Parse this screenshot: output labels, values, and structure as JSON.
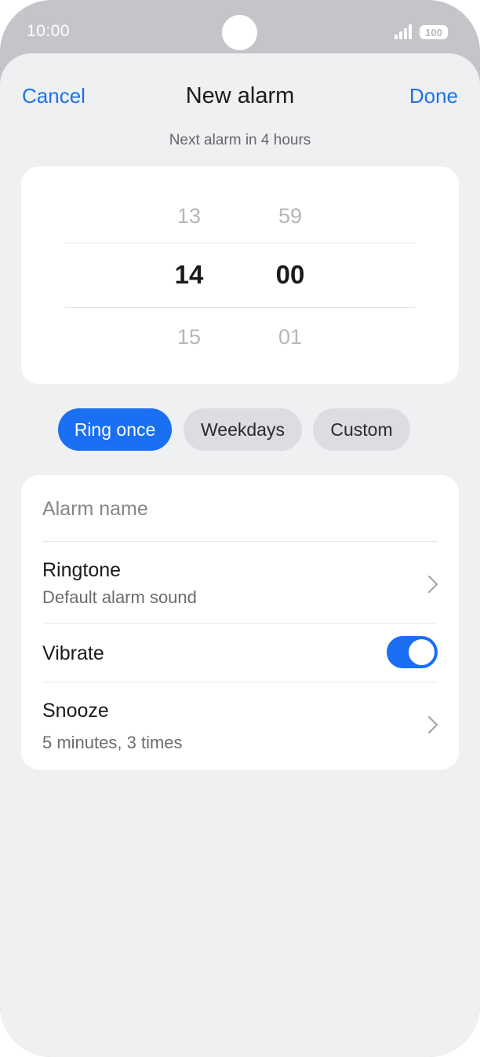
{
  "status": {
    "time": "10:00",
    "battery": "100"
  },
  "nav": {
    "cancel_label": "Cancel",
    "title": "New alarm",
    "done_label": "Done"
  },
  "subtitle": "Next alarm in 4 hours",
  "picker": {
    "hours": {
      "prev": "13",
      "selected": "14",
      "next": "15"
    },
    "minutes": {
      "prev": "59",
      "selected": "00",
      "next": "01"
    }
  },
  "repeat_options": [
    {
      "label": "Ring once",
      "active": true
    },
    {
      "label": "Weekdays",
      "active": false
    },
    {
      "label": "Custom",
      "active": false
    }
  ],
  "settings": {
    "alarm_name_placeholder": "Alarm name",
    "ringtone": {
      "label": "Ringtone",
      "value": "Default alarm sound"
    },
    "vibrate": {
      "label": "Vibrate",
      "enabled": true
    },
    "snooze": {
      "label": "Snooze",
      "value": "5 minutes, 3 times"
    }
  },
  "colors": {
    "accent": "#1a6ff2",
    "link": "#1a73e8",
    "background": "#eff0f2",
    "status_bar": "#c4c5c9"
  },
  "icons": [
    "signal-icon",
    "battery-icon",
    "chevron-right-icon",
    "toggle-switch"
  ]
}
